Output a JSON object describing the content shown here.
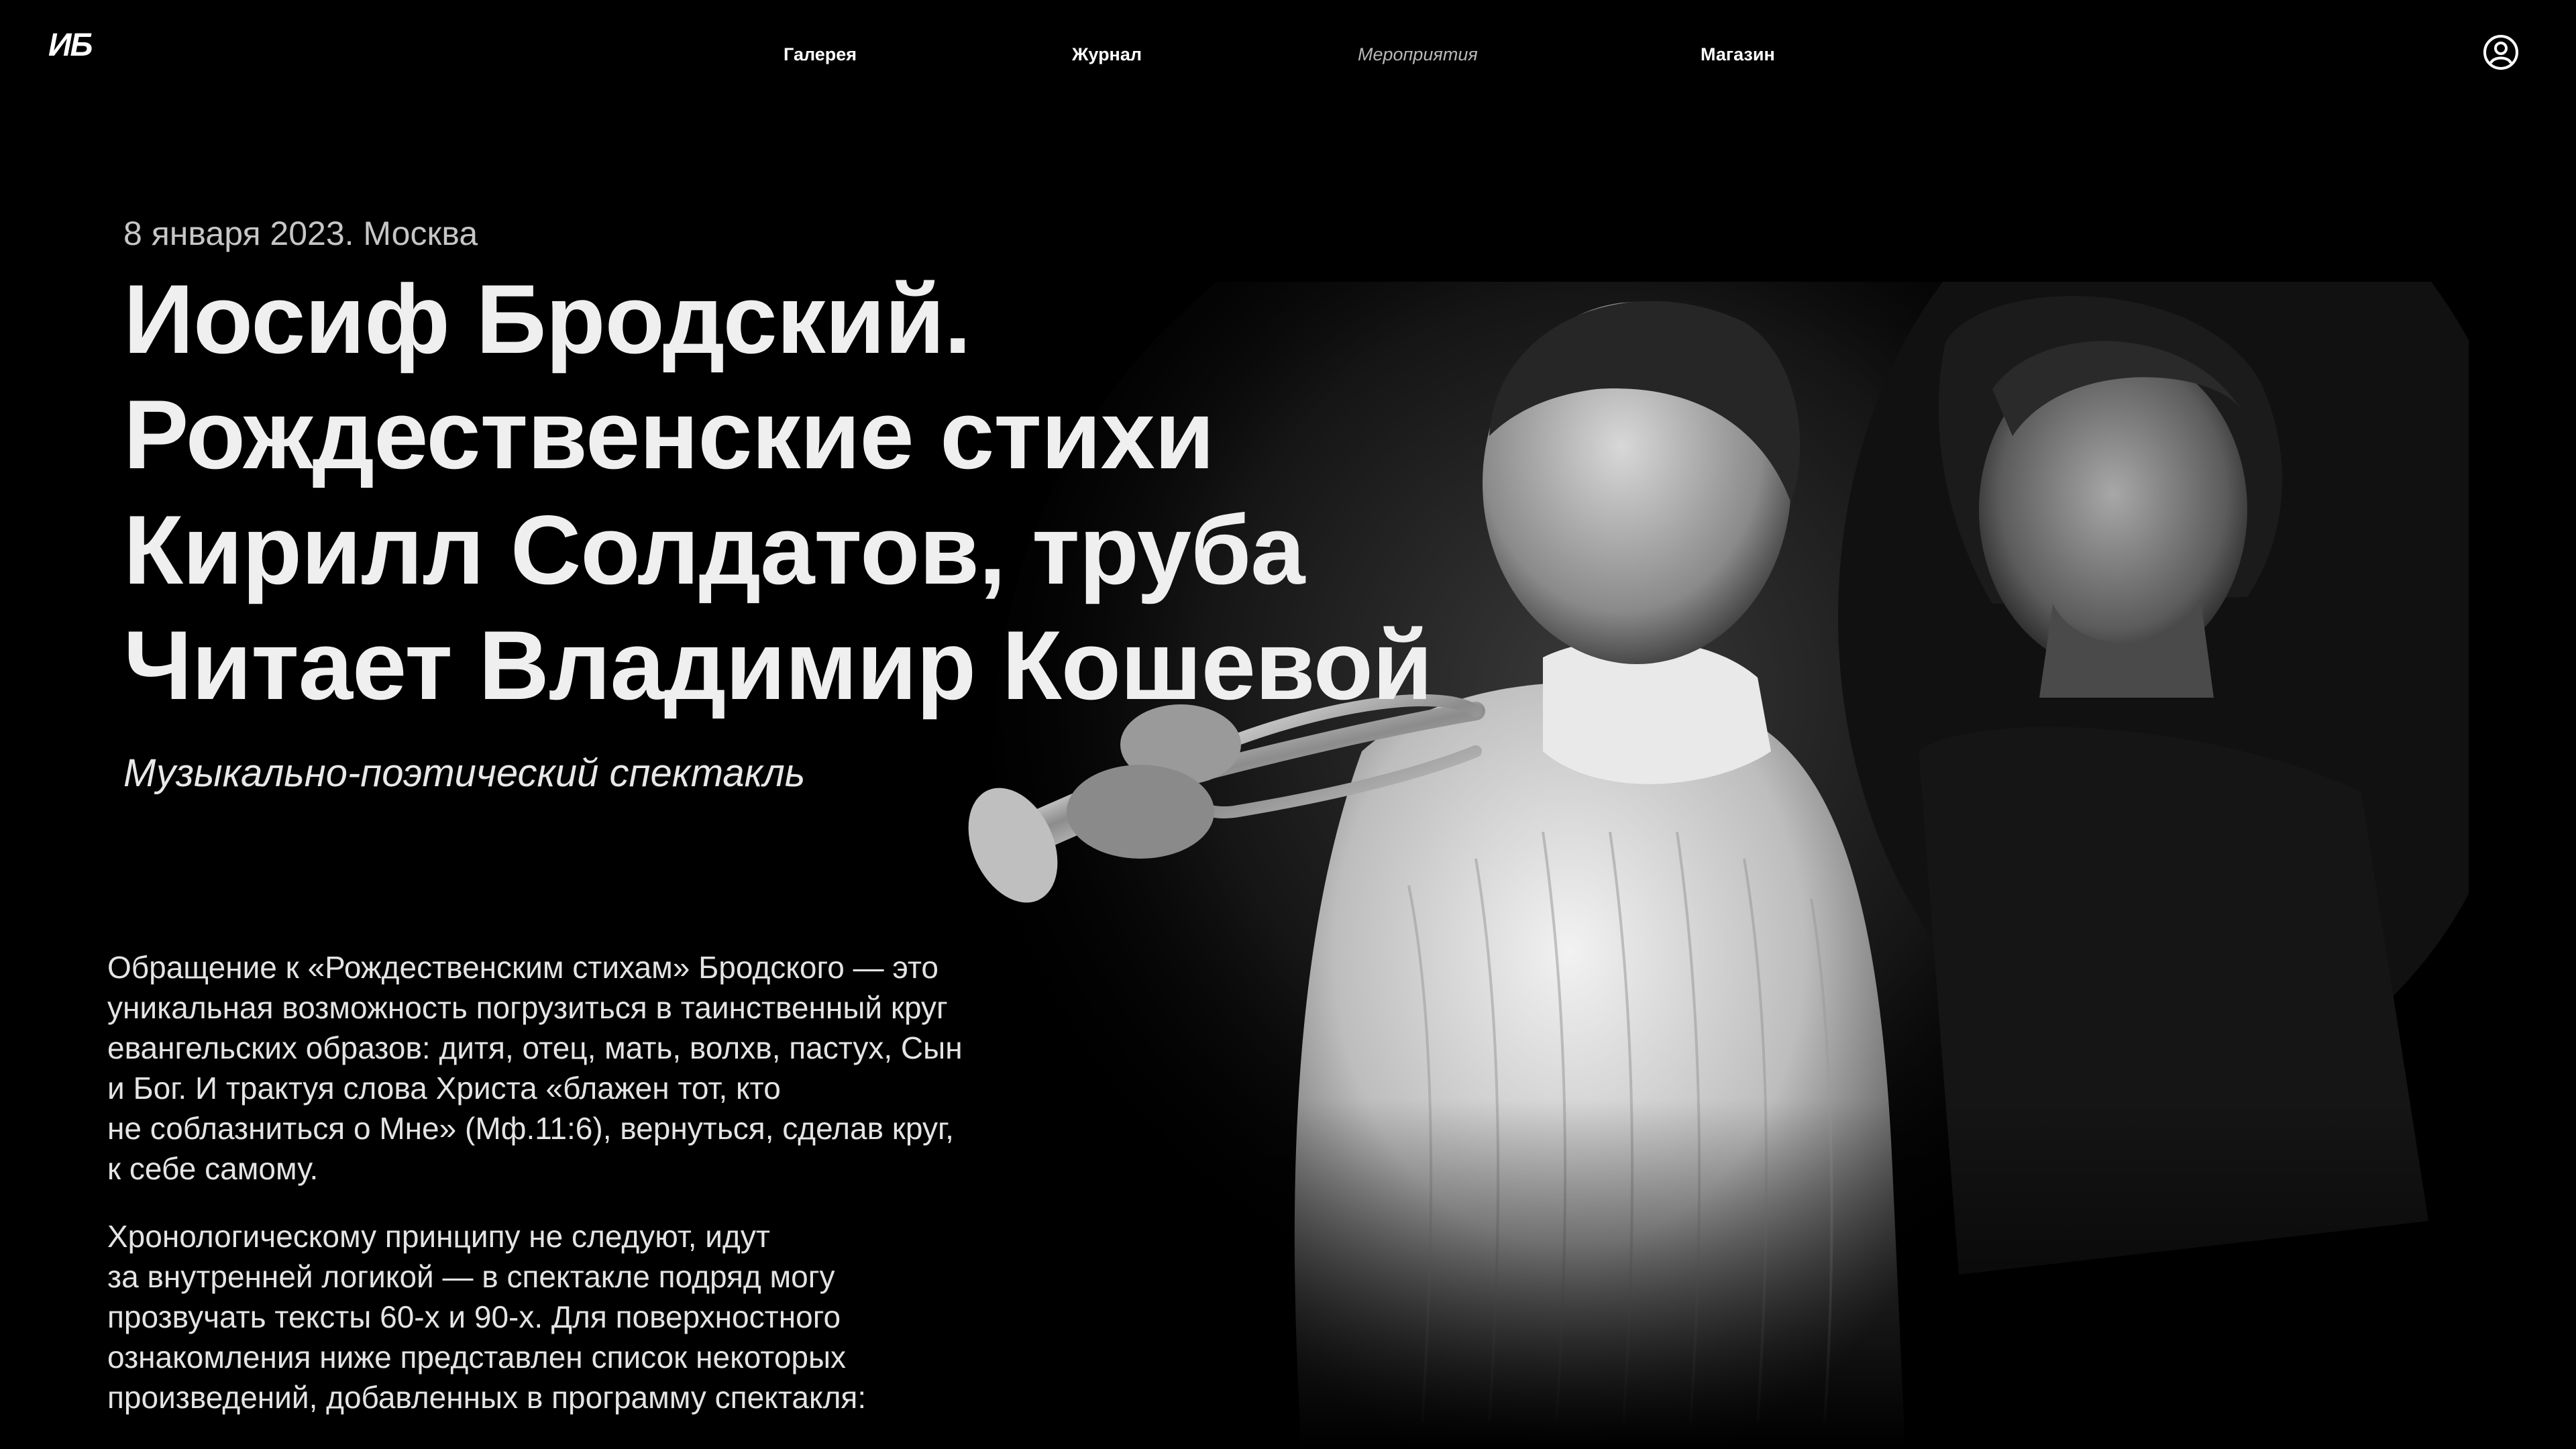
{
  "header": {
    "logo": "ИБ",
    "nav": [
      {
        "label": "Галерея",
        "active": false
      },
      {
        "label": "Журнал",
        "active": false
      },
      {
        "label": "Мероприятия",
        "active": true
      },
      {
        "label": "Магазин",
        "active": false
      }
    ],
    "user_icon": "user-circle-icon"
  },
  "event": {
    "date_place": "8 января 2023. Москва",
    "title_lines": [
      "Иосиф Бродский.",
      "Рождественские стихи",
      "Кирилл Солдатов, труба",
      "Читает Владимир Кошевой"
    ],
    "subtitle": "Музыкально-поэтический спектакль"
  },
  "description": {
    "paragraph1_lines": [
      "Обращение к «Рождественским стихам» Бродского — это",
      "уникальная возможность погрузиться в таинственный круг",
      "евангельских образов: дитя, отец, мать, волхв, пастух, Сын",
      "и Бог. И трактуя слова Христа «блажен тот, кто",
      "не соблазниться о Мне» (Мф.11:6), вернуться, сделав круг,",
      "к себе самому."
    ],
    "paragraph2_lines": [
      "Хронологическому принципу не следуют, идут",
      "за внутренней логикой — в спектакле подряд могу",
      "прозвучать тексты 60-х и 90-х. Для поверхностного",
      "ознакомления ниже представлен список некоторых",
      "произведений, добавленных в программу спектакля:"
    ]
  },
  "colors": {
    "background": "#000000",
    "text": "#ffffff",
    "muted": "#c6c6c6",
    "nav_active": "#b9b9b9"
  }
}
